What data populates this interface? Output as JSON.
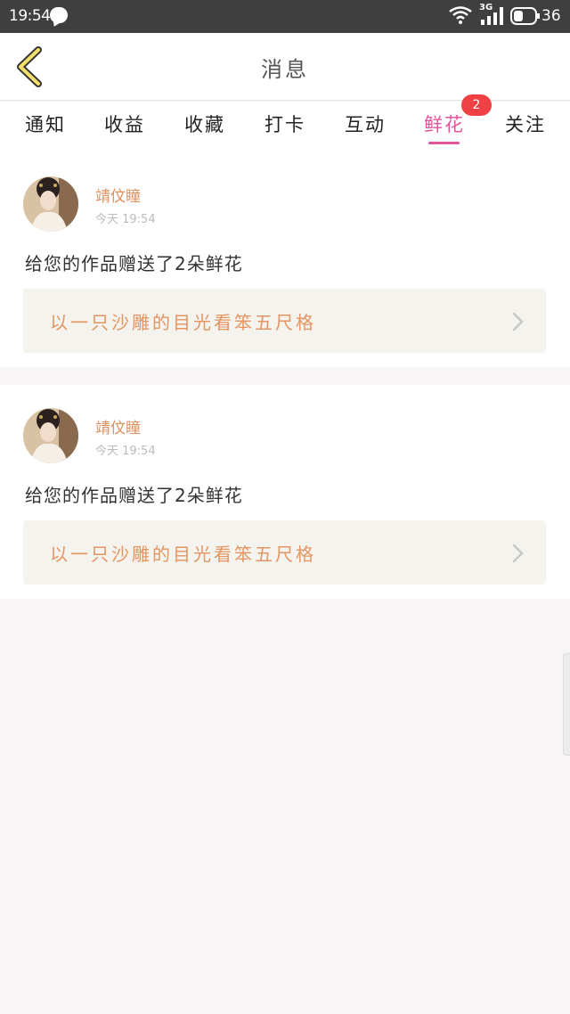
{
  "status_bar": {
    "time": "19:54",
    "network": "3G",
    "battery": "36"
  },
  "header": {
    "title": "消息"
  },
  "tabs": [
    {
      "label": "通知"
    },
    {
      "label": "收益"
    },
    {
      "label": "收藏"
    },
    {
      "label": "打卡"
    },
    {
      "label": "互动"
    },
    {
      "label": "鲜花",
      "active": true,
      "badge": "2"
    },
    {
      "label": "关注"
    }
  ],
  "messages": [
    {
      "username": "靖伩瞳",
      "time": "今天 19:54",
      "text": "给您的作品赠送了2朵鲜花",
      "work_title": "以一只沙雕的目光看笨五尺格"
    },
    {
      "username": "靖伩瞳",
      "time": "今天 19:54",
      "text": "给您的作品赠送了2朵鲜花",
      "work_title": "以一只沙雕的目光看笨五尺格"
    }
  ],
  "colors": {
    "accent": "#e0569a",
    "username": "#e0915f",
    "badge": "#ef4044"
  }
}
